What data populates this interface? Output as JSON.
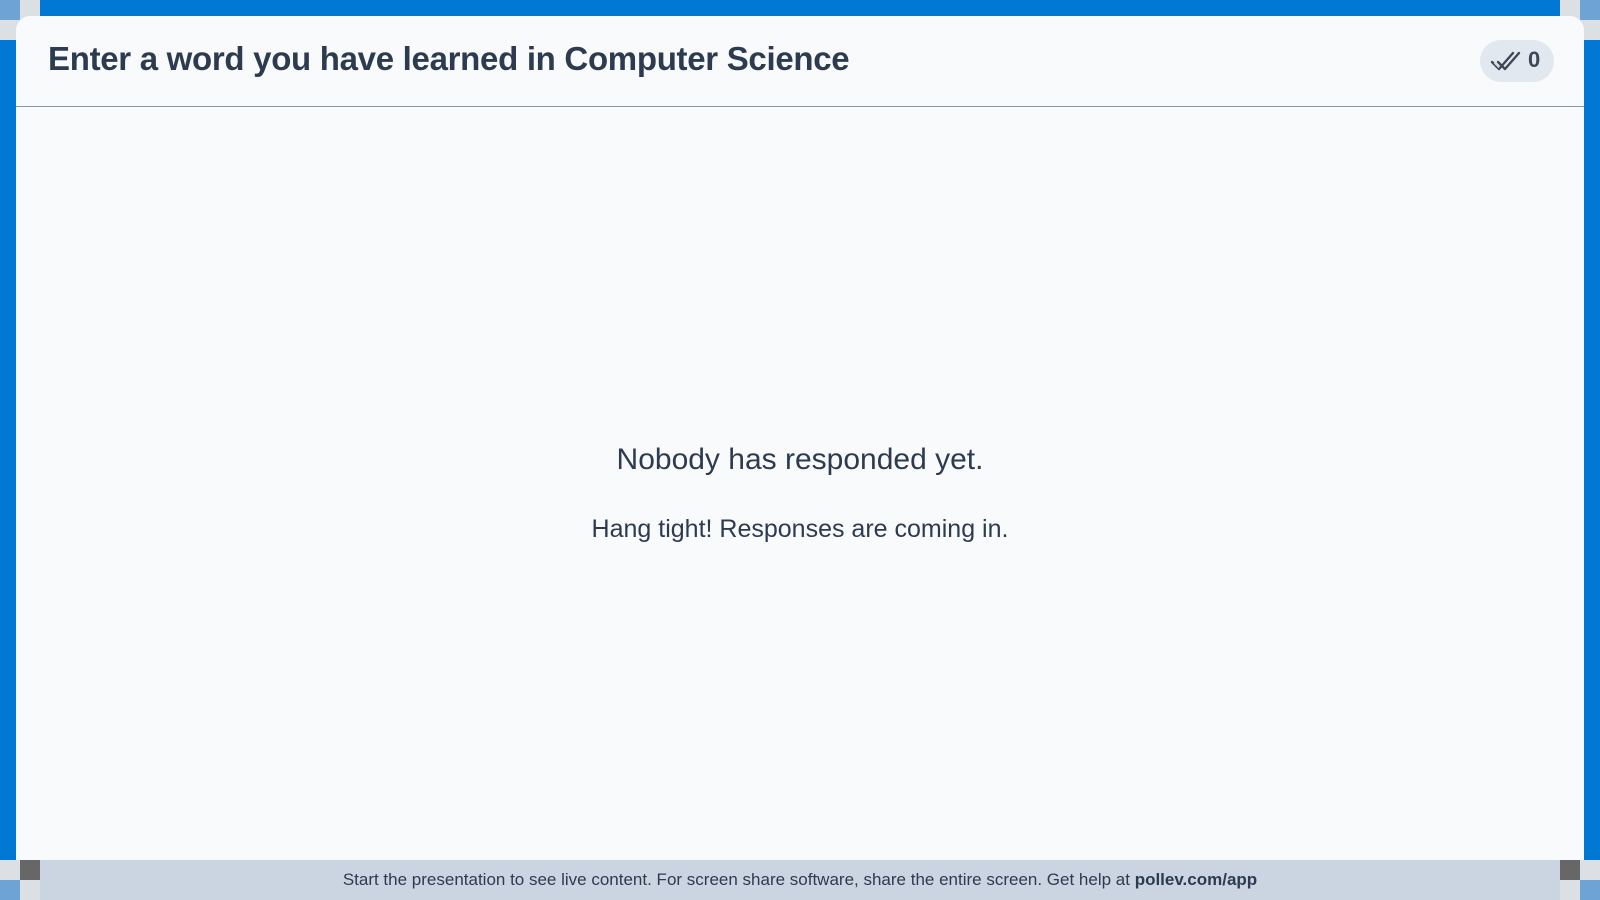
{
  "question": {
    "title": "Enter a word you have learned in Computer Science"
  },
  "responses": {
    "icon": "double-check-icon",
    "count": "0"
  },
  "empty_state": {
    "title": "Nobody has responded yet.",
    "subtitle": "Hang tight! Responses are coming in."
  },
  "footer": {
    "message": "Start the presentation to see live content. For screen share software, share the entire screen. Get help at ",
    "link": "pollev.com/app"
  },
  "colors": {
    "frame": "#0078d4",
    "card": "#f8fafc",
    "text": "#2d3b50",
    "footer": "#cbd5e1"
  }
}
